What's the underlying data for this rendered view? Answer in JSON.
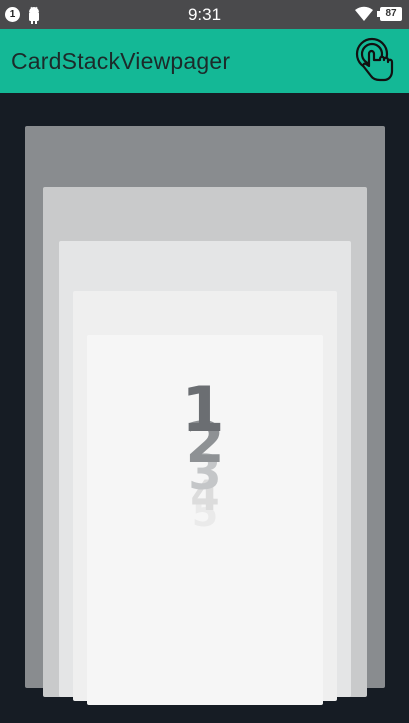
{
  "status_bar": {
    "notification_count": "1",
    "time": "9:31",
    "battery": "87"
  },
  "app_bar": {
    "title": "CardStackViewpager",
    "action_icon": "touch-gesture-icon"
  },
  "cards": [
    {
      "label": "5",
      "color": "#f2f2f2"
    },
    {
      "label": "4",
      "color": "#e8e8e8"
    },
    {
      "label": "3",
      "color": "#c4c6c8"
    },
    {
      "label": "2",
      "color": "#8e9194"
    },
    {
      "label": "1",
      "color": "#6b6e72"
    }
  ],
  "colors": {
    "status_bar": "#4a4a4c",
    "app_bar": "#14b896",
    "background": "#161c24"
  }
}
